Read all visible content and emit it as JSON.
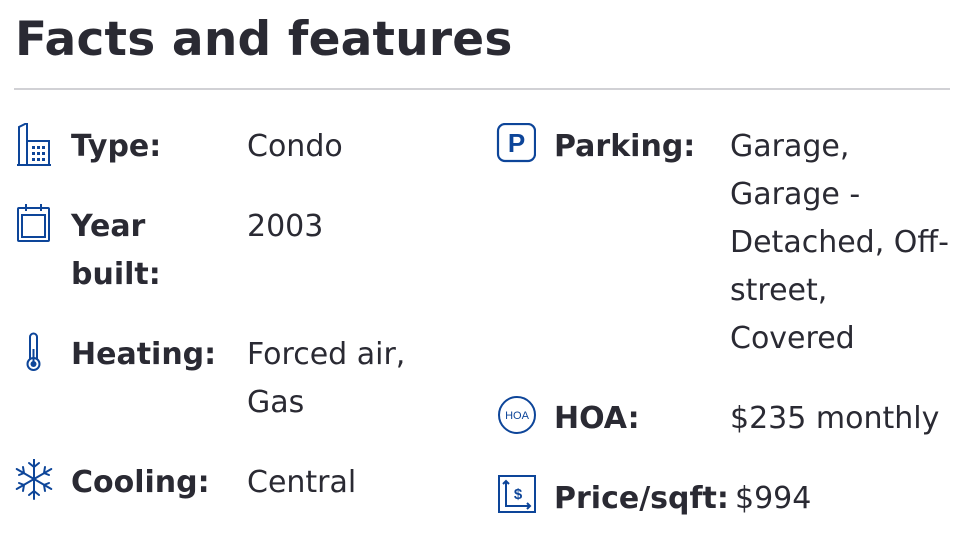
{
  "section": {
    "title": "Facts and features"
  },
  "left_column": [
    {
      "icon": "building-icon",
      "label": "Type:",
      "value": "Condo"
    },
    {
      "icon": "calendar-icon",
      "label": "Year built:",
      "value": "2003"
    },
    {
      "icon": "thermometer-icon",
      "label": "Heating:",
      "value": "Forced air, Gas"
    },
    {
      "icon": "snowflake-icon",
      "label": "Cooling:",
      "value": "Central"
    }
  ],
  "right_column": [
    {
      "icon": "parking-icon",
      "icon_text": "P",
      "label": "Parking:",
      "value": "Garage, Garage - Detached, Off-street, Covered"
    },
    {
      "icon": "hoa-icon",
      "icon_text": "HOA",
      "label": "HOA:",
      "value": "$235 monthly"
    },
    {
      "icon": "price-per-sqft-icon",
      "icon_text": "$",
      "label": "Price/sqft:",
      "value": "$994"
    }
  ],
  "colors": {
    "text": "#2a2a33",
    "icon": "#0d4599",
    "divider": "#d1d1d5"
  }
}
